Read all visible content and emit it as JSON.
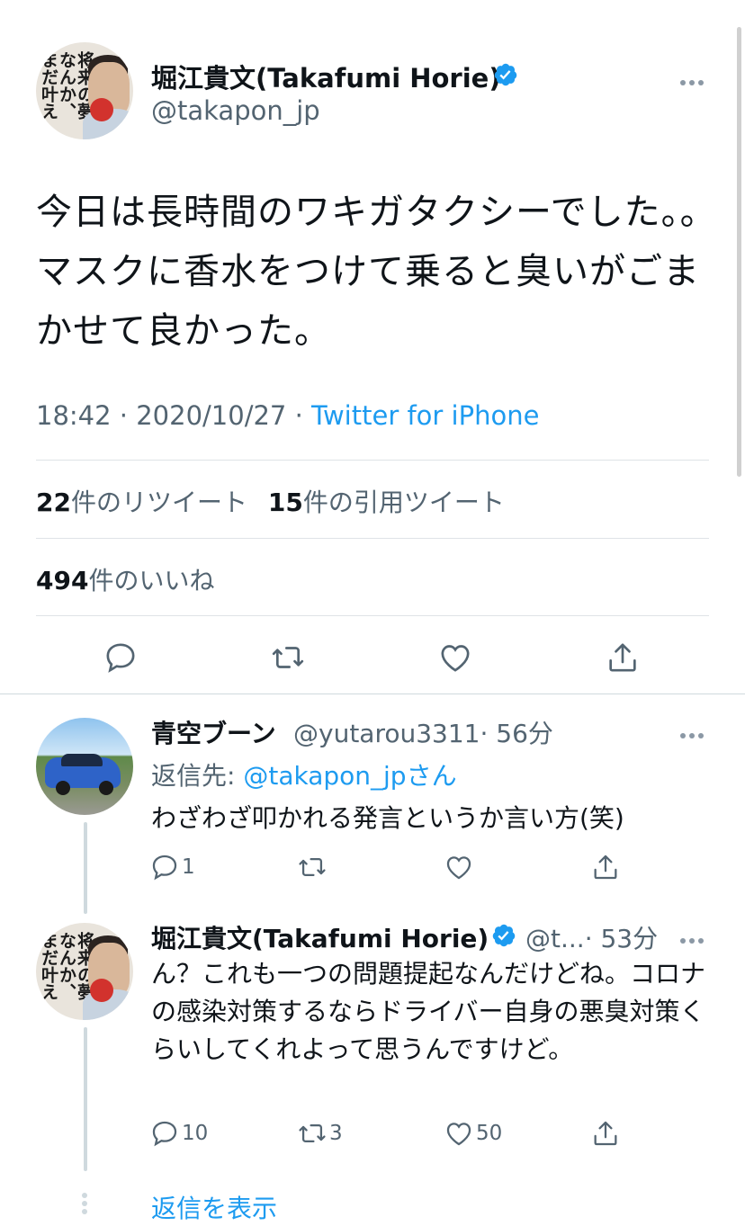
{
  "main_tweet": {
    "author_name": "堀江貴文(Takafumi Horie)",
    "author_handle": "@takapon_jp",
    "avatar_text": "将来の夢なんか、まだ叶えろ",
    "text": "今日は長時間のワキガタクシーでした。。マスクに香水をつけて乗ると臭いがごまかせて良かった。",
    "time": "18:42",
    "date": "2020/10/27",
    "separator": "·",
    "source": "Twitter for iPhone",
    "retweet_count": "22",
    "retweet_label": "件のリツイート",
    "quote_count": "15",
    "quote_label": "件の引用ツイート",
    "like_count": "494",
    "like_label": "件のいいね"
  },
  "reply_1": {
    "author_name": "青空ブーン",
    "author_handle": "@yutarou3311",
    "time": "· 56分",
    "reply_to_label": "返信先:",
    "reply_to_mention": "@takapon_jpさん",
    "text": "わざわざ叩かれる発言というか言い方(笑)",
    "reply_count": "1",
    "retweet_count": "",
    "like_count": ""
  },
  "reply_2": {
    "author_name": "堀江貴文(Takafumi Horie)",
    "author_handle": "@t...",
    "time": "· 53分",
    "text": "ん？これも一つの問題提起なんだけどね。コロナの感染対策するならドライバー自身の悪臭対策くらいしてくれよって思うんですけど。",
    "reply_count": "10",
    "retweet_count": "3",
    "like_count": "50"
  },
  "show_replies_label": "返信を表示",
  "colors": {
    "accent": "#1d9bf0",
    "text": "#0f1419",
    "secondary": "#536471",
    "divider": "#dfe3e7"
  }
}
